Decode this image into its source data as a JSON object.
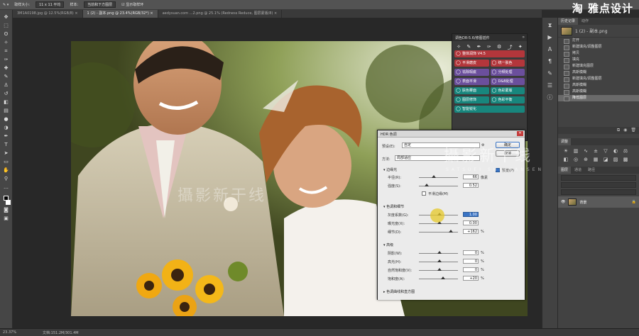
{
  "brand": "淘 雅点设计",
  "options_bar": {
    "tool_icon": "brush-tool-icon",
    "sample_label": "取样大小:",
    "sample_value": "11 x 11 平均",
    "sample_from_label": "样本:",
    "sample_from_value": "当前和下方图层",
    "show_ring_label": "显示取样环"
  },
  "tabs": [
    {
      "label": "3M1A0198.jpg @ 12.5%(RGB/8) ×",
      "active": false
    },
    {
      "label": "1 (2) - 副本.png @ 23.4%(RGB/32*) ×",
      "active": true
    },
    {
      "label": "aedysuan.com ...2.png @ 25.1% (Redness Reduce, 图层蒙版/8) ×",
      "active": false
    }
  ],
  "plugin_panel": {
    "title": "调色DR-5.6/修图插件",
    "tool_icons": [
      "wand-icon",
      "brush-icon",
      "pen-icon",
      "eyedropper-icon",
      "gear-icon",
      "export-icon",
      "star-icon"
    ],
    "buttons": [
      {
        "label": "整体润饰 V4.5",
        "color": "red"
      },
      {
        "label": "平滑磨皮",
        "color": "red"
      },
      {
        "label": "统一肤色",
        "color": "red"
      },
      {
        "label": "祛除瑕疵",
        "color": "purple"
      },
      {
        "label": "分频处理",
        "color": "purple"
      },
      {
        "label": "表面平滑",
        "color": "purple"
      },
      {
        "label": "D&B处理",
        "color": "purple"
      },
      {
        "label": "肤色雾面",
        "color": "teal"
      },
      {
        "label": "色彩蒙版",
        "color": "teal"
      },
      {
        "label": "图层修饰",
        "color": "teal"
      },
      {
        "label": "色彩平衡",
        "color": "teal"
      },
      {
        "label": "智能锐化",
        "color": "teal"
      }
    ]
  },
  "dialog": {
    "title": "HDR 色调",
    "preset_label": "预设(E):",
    "preset_value": "自定",
    "method_label": "方法:",
    "method_value": "局部适应",
    "ok_label": "确定",
    "cancel_label": "取消",
    "preview_label": "预览(P)",
    "section_edge": "边缘光",
    "radius_label": "半径(R):",
    "radius_value": "66",
    "radius_unit": "像素",
    "strength_label": "强度(S):",
    "strength_value": "0.52",
    "smooth_edges_label": "平滑边缘(M)",
    "section_tone": "色调和细节",
    "gamma_label": "灰度系数(G):",
    "gamma_value": "1.00",
    "exposure_label": "曝光度(X):",
    "exposure_value": "0.00",
    "detail_label": "细节(D):",
    "detail_value": "+162",
    "detail_unit": "%",
    "section_advanced": "高级",
    "shadow_label": "阴影(W):",
    "shadow_value": "0",
    "highlight_label": "高光(H):",
    "highlight_value": "0",
    "vibrance_label": "自然饱和度(V):",
    "vibrance_value": "0",
    "saturation_label": "饱和度(A):",
    "saturation_value": "+20",
    "percent": "%",
    "section_curve": "色调曲线和直方图"
  },
  "watermark": {
    "main": "攝影新干线",
    "sub": "SATSUEI SHINKANSEN",
    "photo": "攝影新干线"
  },
  "right_panel": {
    "tabs": [
      "历史记录",
      "动作"
    ],
    "snapshot": "1 (2) - 副本.png",
    "history": [
      "打开",
      "新建填充/调整图层",
      "拷贝",
      "填充",
      "新建填充图层",
      "高斯模糊",
      "新建填充/调整图层",
      "高斯模糊",
      "高斯模糊",
      "降低图层"
    ],
    "adjust_title": "调整",
    "layers_tabs": [
      "图层",
      "通道",
      "路径"
    ],
    "layer_name": "背景"
  },
  "status": {
    "zoom": "23.37%",
    "doc": "文档:151.2M/301.4M"
  },
  "tool_icons": [
    "move-icon",
    "marquee-icon",
    "lasso-icon",
    "quick-select-icon",
    "crop-icon",
    "eyedropper-icon",
    "healing-icon",
    "brush-icon",
    "stamp-icon",
    "history-brush-icon",
    "eraser-icon",
    "gradient-icon",
    "blur-icon",
    "dodge-icon",
    "pen-icon",
    "type-icon",
    "path-select-icon",
    "shape-icon",
    "hand-icon",
    "zoom-icon"
  ],
  "colors": {
    "accent_red": "#b3363b",
    "accent_purple": "#6b4f9c",
    "accent_teal": "#18867d",
    "selection_blue": "#3a74c4"
  }
}
